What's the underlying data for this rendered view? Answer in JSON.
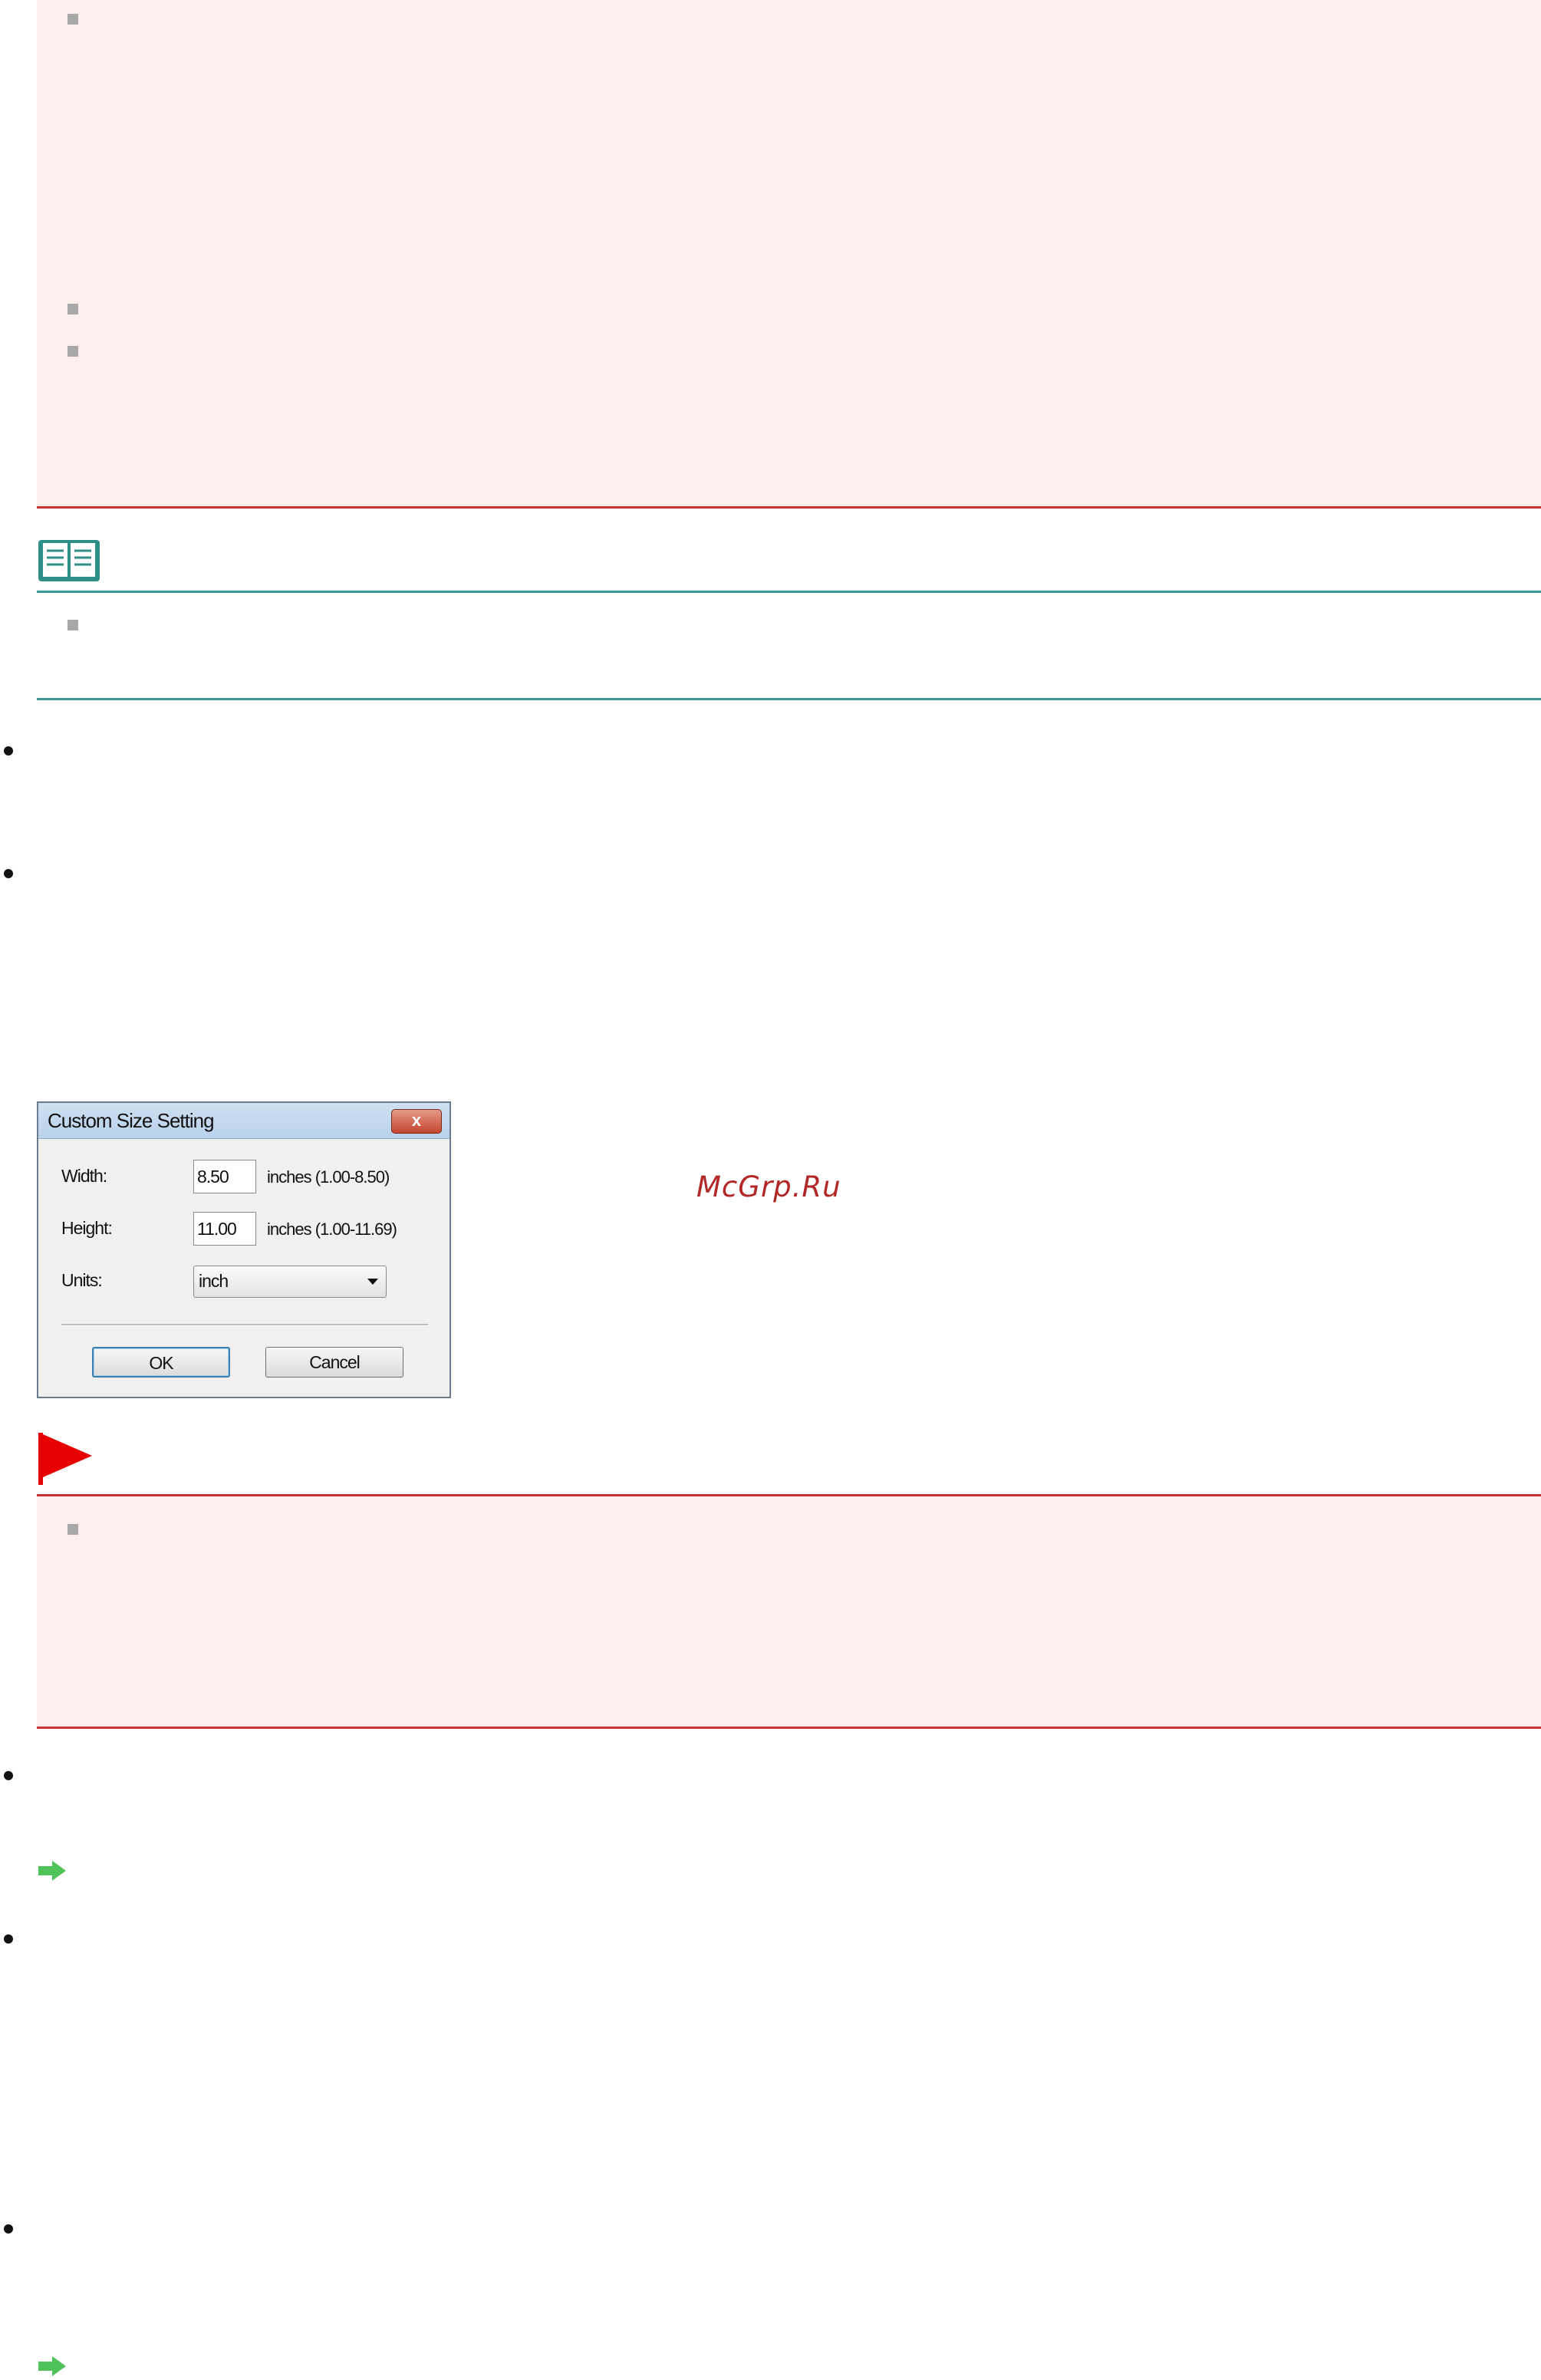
{
  "dialog": {
    "title": "Custom Size Setting",
    "close_label": "x",
    "width_label": "Width:",
    "width_value": "8.50",
    "width_range": "inches (1.00-8.50)",
    "height_label": "Height:",
    "height_value": "11.00",
    "height_range": "inches (1.00-11.69)",
    "units_label": "Units:",
    "units_value": "inch",
    "ok_label": "OK",
    "cancel_label": "Cancel"
  },
  "watermark": "McGrp.Ru",
  "icons": {
    "note": "note-book-icon",
    "important": "red-flag-icon",
    "link": "green-arrow-icon"
  },
  "colors": {
    "important_border": "#c83232",
    "important_bg": "#fdeeee",
    "note_border": "#3b9a94",
    "flag": "#e60000",
    "arrow": "#4fc25a"
  }
}
